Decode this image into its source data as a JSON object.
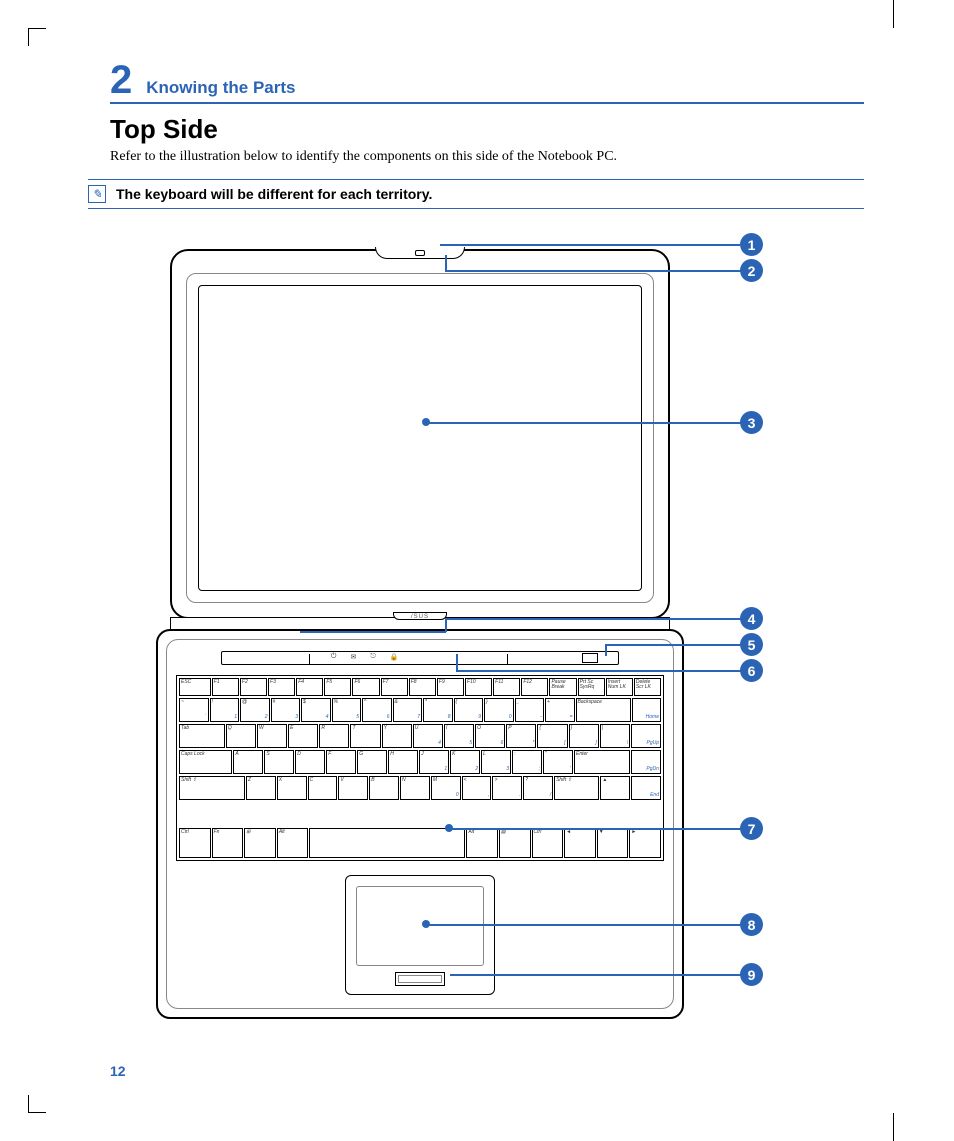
{
  "chapter": {
    "number": "2",
    "title": "Knowing the Parts"
  },
  "section": {
    "title": "Top Side",
    "intro": "Refer to the illustration below to identify the components on this side of the Notebook PC."
  },
  "note": {
    "icon": "✎",
    "text": "The keyboard will be different for each territory."
  },
  "logo": "/SUS",
  "callouts": [
    "1",
    "2",
    "3",
    "4",
    "5",
    "6",
    "7",
    "8",
    "9"
  ],
  "page_number": "12",
  "keyboard": {
    "row0": [
      "ESC",
      "F1",
      "F2",
      "F3",
      "F4",
      "F5",
      "F6",
      "F7",
      "F8",
      "F9",
      "F10",
      "F11",
      "F12",
      "Pause Break",
      "Prt Sc SysRq",
      "Insert Num LK",
      "Delete Scr LK"
    ],
    "row1": [
      [
        "~",
        "`"
      ],
      [
        "!",
        "1"
      ],
      [
        "@",
        "2"
      ],
      [
        "#",
        "3"
      ],
      [
        "$",
        "4"
      ],
      [
        "%",
        "5"
      ],
      [
        "^",
        "6"
      ],
      [
        "&",
        "7"
      ],
      [
        "*",
        "8"
      ],
      [
        "(",
        "9"
      ],
      [
        ")",
        "0"
      ],
      [
        "_",
        "-"
      ],
      [
        "+",
        "="
      ],
      [
        "Backspace",
        ""
      ],
      [
        "",
        "Home"
      ]
    ],
    "row2": [
      [
        "Tab",
        ""
      ],
      [
        "Q",
        ""
      ],
      [
        "W",
        ""
      ],
      [
        "E",
        ""
      ],
      [
        "R",
        ""
      ],
      [
        "T",
        ""
      ],
      [
        "Y",
        ""
      ],
      [
        "U",
        "4"
      ],
      [
        "I",
        "5"
      ],
      [
        "O",
        "6"
      ],
      [
        "P",
        "*"
      ],
      [
        "{",
        "["
      ],
      [
        "}",
        "]"
      ],
      [
        "|",
        "\\"
      ],
      [
        "",
        "PgUp"
      ]
    ],
    "row3": [
      [
        "Caps Lock",
        ""
      ],
      [
        "A",
        ""
      ],
      [
        "S",
        ""
      ],
      [
        "D",
        ""
      ],
      [
        "F",
        ""
      ],
      [
        "G",
        ""
      ],
      [
        "H",
        ""
      ],
      [
        "J",
        "1"
      ],
      [
        "K",
        "2"
      ],
      [
        "L",
        "3"
      ],
      [
        ":",
        ";"
      ],
      [
        "\"",
        "'"
      ],
      [
        "Enter",
        ""
      ],
      [
        "",
        "PgDn"
      ]
    ],
    "row4": [
      [
        "Shift ⇧",
        ""
      ],
      [
        "Z",
        ""
      ],
      [
        "X",
        ""
      ],
      [
        "C",
        ""
      ],
      [
        "V",
        ""
      ],
      [
        "B",
        ""
      ],
      [
        "N",
        ""
      ],
      [
        "M",
        "0"
      ],
      [
        "<",
        ","
      ],
      [
        ">",
        "."
      ],
      [
        "?",
        "/"
      ],
      [
        "Shift ⇧",
        ""
      ],
      [
        "▲",
        ""
      ],
      [
        "",
        "End"
      ]
    ],
    "row5": [
      [
        "Ctrl",
        ""
      ],
      [
        "Fn",
        ""
      ],
      [
        "⊞",
        ""
      ],
      [
        "Alt",
        ""
      ],
      [
        "",
        ""
      ],
      [
        "Alt",
        ""
      ],
      [
        "▤",
        ""
      ],
      [
        "Ctrl",
        ""
      ],
      [
        "◄",
        ""
      ],
      [
        "▼",
        ""
      ],
      [
        "►",
        ""
      ]
    ]
  }
}
